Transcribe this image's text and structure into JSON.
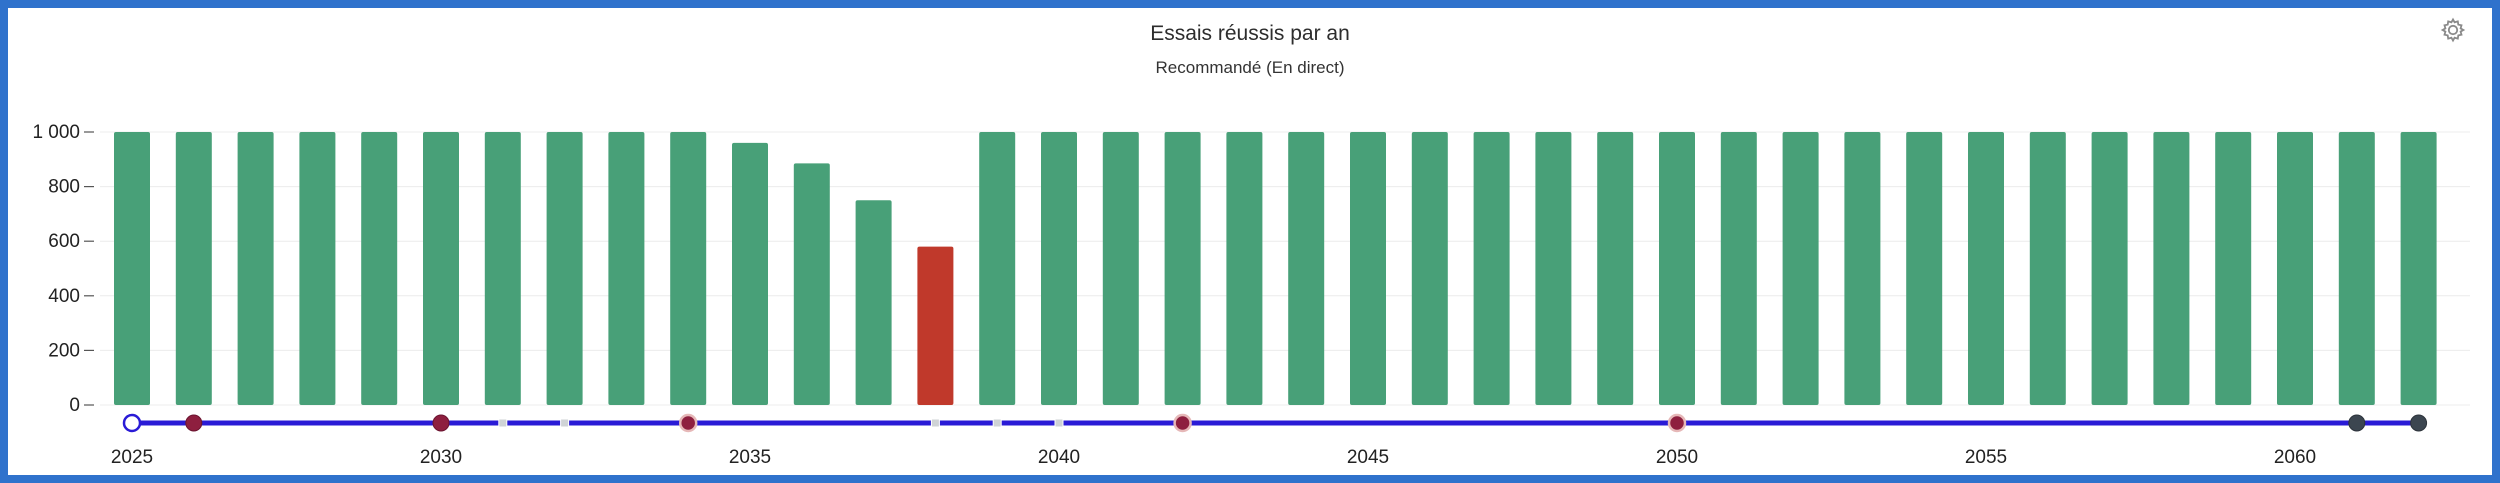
{
  "chart_data": {
    "type": "bar",
    "title": "Essais réussis par an",
    "subtitle": "Recommandé (En direct)",
    "xlabel": "",
    "ylabel": "",
    "ylim": [
      0,
      1000
    ],
    "yticks": [
      {
        "value": 0,
        "label": "0"
      },
      {
        "value": 200,
        "label": "200"
      },
      {
        "value": 400,
        "label": "400"
      },
      {
        "value": 600,
        "label": "600"
      },
      {
        "value": 800,
        "label": "800"
      },
      {
        "value": 1000,
        "label": "1 000"
      }
    ],
    "xticks": [
      {
        "value": 2025,
        "label": "2025"
      },
      {
        "value": 2030,
        "label": "2030"
      },
      {
        "value": 2035,
        "label": "2035"
      },
      {
        "value": 2040,
        "label": "2040"
      },
      {
        "value": 2045,
        "label": "2045"
      },
      {
        "value": 2050,
        "label": "2050"
      },
      {
        "value": 2055,
        "label": "2055"
      },
      {
        "value": 2060,
        "label": "2060"
      }
    ],
    "categories": [
      2025,
      2026,
      2027,
      2028,
      2029,
      2030,
      2031,
      2032,
      2033,
      2034,
      2035,
      2036,
      2037,
      2038,
      2039,
      2040,
      2041,
      2042,
      2043,
      2044,
      2045,
      2046,
      2047,
      2048,
      2049,
      2050,
      2051,
      2052,
      2053,
      2054,
      2055,
      2056,
      2057,
      2058,
      2059,
      2060,
      2061,
      2062
    ],
    "values": [
      1000,
      1000,
      1000,
      1000,
      1000,
      1000,
      1000,
      1000,
      1000,
      1000,
      960,
      885,
      750,
      580,
      1000,
      1000,
      1000,
      1000,
      1000,
      1000,
      1000,
      1000,
      1000,
      1000,
      1000,
      1000,
      1000,
      1000,
      1000,
      1000,
      1000,
      1000,
      1000,
      1000,
      1000,
      1000,
      1000,
      1000
    ],
    "highlight": {
      "year": 2038,
      "color": "#c0392b"
    },
    "bar_color": "#48a078",
    "timeline": {
      "line_color": "#2a1bd6",
      "markers": [
        {
          "year": 2025,
          "kind": "open-circle"
        },
        {
          "year": 2026,
          "kind": "filled-maroon"
        },
        {
          "year": 2030,
          "kind": "filled-maroon"
        },
        {
          "year": 2031,
          "kind": "small-square"
        },
        {
          "year": 2032,
          "kind": "small-square"
        },
        {
          "year": 2034,
          "kind": "ringed-maroon"
        },
        {
          "year": 2038,
          "kind": "small-square"
        },
        {
          "year": 2039,
          "kind": "small-square"
        },
        {
          "year": 2040,
          "kind": "small-square"
        },
        {
          "year": 2042,
          "kind": "ringed-maroon"
        },
        {
          "year": 2050,
          "kind": "ringed-maroon"
        },
        {
          "year": 2061,
          "kind": "filled-dark"
        },
        {
          "year": 2062,
          "kind": "filled-dark"
        }
      ]
    },
    "grid": true
  },
  "icons": {
    "settings": "gear-icon"
  }
}
